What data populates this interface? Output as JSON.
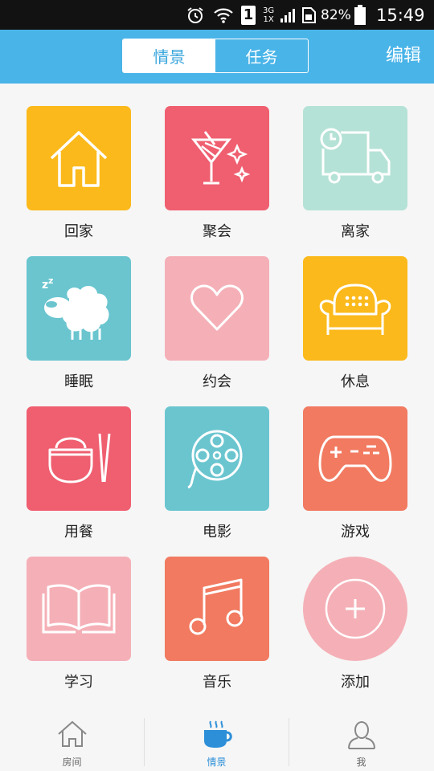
{
  "status_bar": {
    "network": "3G",
    "network_sub": "1X",
    "sim": "1",
    "battery": "82%",
    "time": "15:49"
  },
  "header": {
    "tabs": [
      {
        "label": "情景",
        "active": true
      },
      {
        "label": "任务",
        "active": false
      }
    ],
    "edit_label": "编辑",
    "accent": "#49b4e8"
  },
  "scenes": [
    {
      "label": "回家",
      "icon": "home-icon",
      "color": "#fbb91b"
    },
    {
      "label": "聚会",
      "icon": "cocktail-icon",
      "color": "#ef5f70"
    },
    {
      "label": "离家",
      "icon": "truck-clock-icon",
      "color": "#b5e2d6"
    },
    {
      "label": "睡眠",
      "icon": "sheep-sleep-icon",
      "color": "#6ac5cf"
    },
    {
      "label": "约会",
      "icon": "heart-icon",
      "color": "#f5b0b7"
    },
    {
      "label": "休息",
      "icon": "sofa-icon",
      "color": "#fbb91b"
    },
    {
      "label": "用餐",
      "icon": "bowl-chopsticks-icon",
      "color": "#ef5f70"
    },
    {
      "label": "电影",
      "icon": "film-reel-icon",
      "color": "#6ac5cf"
    },
    {
      "label": "游戏",
      "icon": "gamepad-icon",
      "color": "#f17a60"
    },
    {
      "label": "学习",
      "icon": "book-icon",
      "color": "#f5b0b7"
    },
    {
      "label": "音乐",
      "icon": "music-note-icon",
      "color": "#f17a60"
    },
    {
      "label": "添加",
      "icon": "plus-icon",
      "color": "#f5b0b7"
    }
  ],
  "tab_bar": {
    "items": [
      {
        "label": "房间",
        "icon": "house-outline-icon",
        "active": false
      },
      {
        "label": "情景",
        "icon": "cup-icon",
        "active": true
      },
      {
        "label": "我",
        "icon": "person-icon",
        "active": false
      }
    ],
    "active_color": "#2d8fd8"
  }
}
